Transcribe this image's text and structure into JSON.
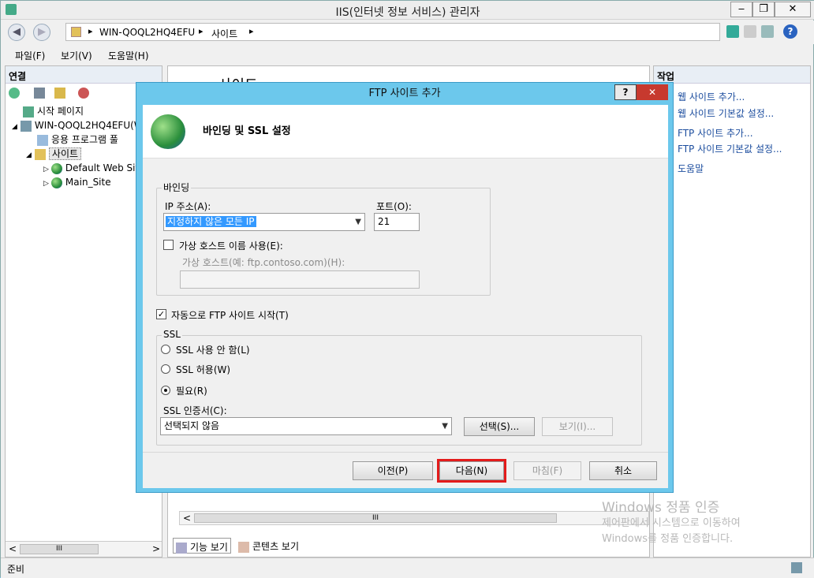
{
  "window": {
    "title": "IIS(인터넷 정보 서비스) 관리자",
    "minimize": "‒",
    "restore": "❐",
    "close": "✕"
  },
  "address": {
    "back": "◀",
    "forward": "▶",
    "crumbs": [
      "WIN-QOQL2HQ4EFU",
      "사이트"
    ],
    "sep": "▸",
    "help": "?"
  },
  "menu": {
    "file": "파일(F)",
    "view": "보기(V)",
    "help": "도움말(H)"
  },
  "left": {
    "header": "연결",
    "tree": [
      {
        "label": "시작 페이지"
      },
      {
        "label": "WIN-QOQL2HQ4EFU(W"
      },
      {
        "label": "응용 프로그램 풀"
      },
      {
        "label": "사이트"
      },
      {
        "label": "Default Web Sit"
      },
      {
        "label": "Main_Site"
      }
    ]
  },
  "center": {
    "partial_title": "사이트",
    "hscroll": "III",
    "tabs": {
      "features": "기능 보기",
      "content": "콘텐츠 보기"
    }
  },
  "right": {
    "header": "작업",
    "actions": [
      "웹 사이트 추가...",
      "웹 사이트 기본값 설정...",
      "FTP 사이트 추가...",
      "FTP 사이트 기본값 설정...",
      "도움말"
    ]
  },
  "status": {
    "text": "준비"
  },
  "leftscroll": {
    "label": "III"
  },
  "dialog": {
    "title": "FTP 사이트 추가",
    "help_btn": "?",
    "close_btn": "✕",
    "heading": "바인딩 및 SSL 설정",
    "binding": {
      "group": "바인딩",
      "ip_label": "IP 주소(A):",
      "ip_value": "지정하지 않은 모든 IP",
      "port_label": "포트(O):",
      "port_value": "21",
      "vhost_check": "가상 호스트 이름 사용(E):",
      "vhost_label": "가상 호스트(예: ftp.contoso.com)(H):",
      "vhost_value": ""
    },
    "autostart": {
      "label": "자동으로 FTP 사이트 시작(T)",
      "checked": true
    },
    "ssl": {
      "group": "SSL",
      "options": [
        "SSL 사용 안 함(L)",
        "SSL 허용(W)",
        "필요(R)"
      ],
      "selected": "필요(R)",
      "cert_label": "SSL 인증서(C):",
      "cert_value": "선택되지 않음",
      "select_btn": "선택(S)...",
      "view_btn": "보기(I)..."
    },
    "buttons": {
      "prev": "이전(P)",
      "next": "다음(N)",
      "finish": "마침(F)",
      "cancel": "취소"
    }
  },
  "watermark": {
    "line1": "Windows 정품 인증",
    "line2": "제어판에서 시스템으로 이동하여",
    "line3": "Windows를 정품 인증합니다."
  },
  "colors": {
    "highlight": "#e31b1b",
    "selection": "#3399ff",
    "link": "#1c4d9e",
    "dialog_frame": "#6cc8ec"
  }
}
